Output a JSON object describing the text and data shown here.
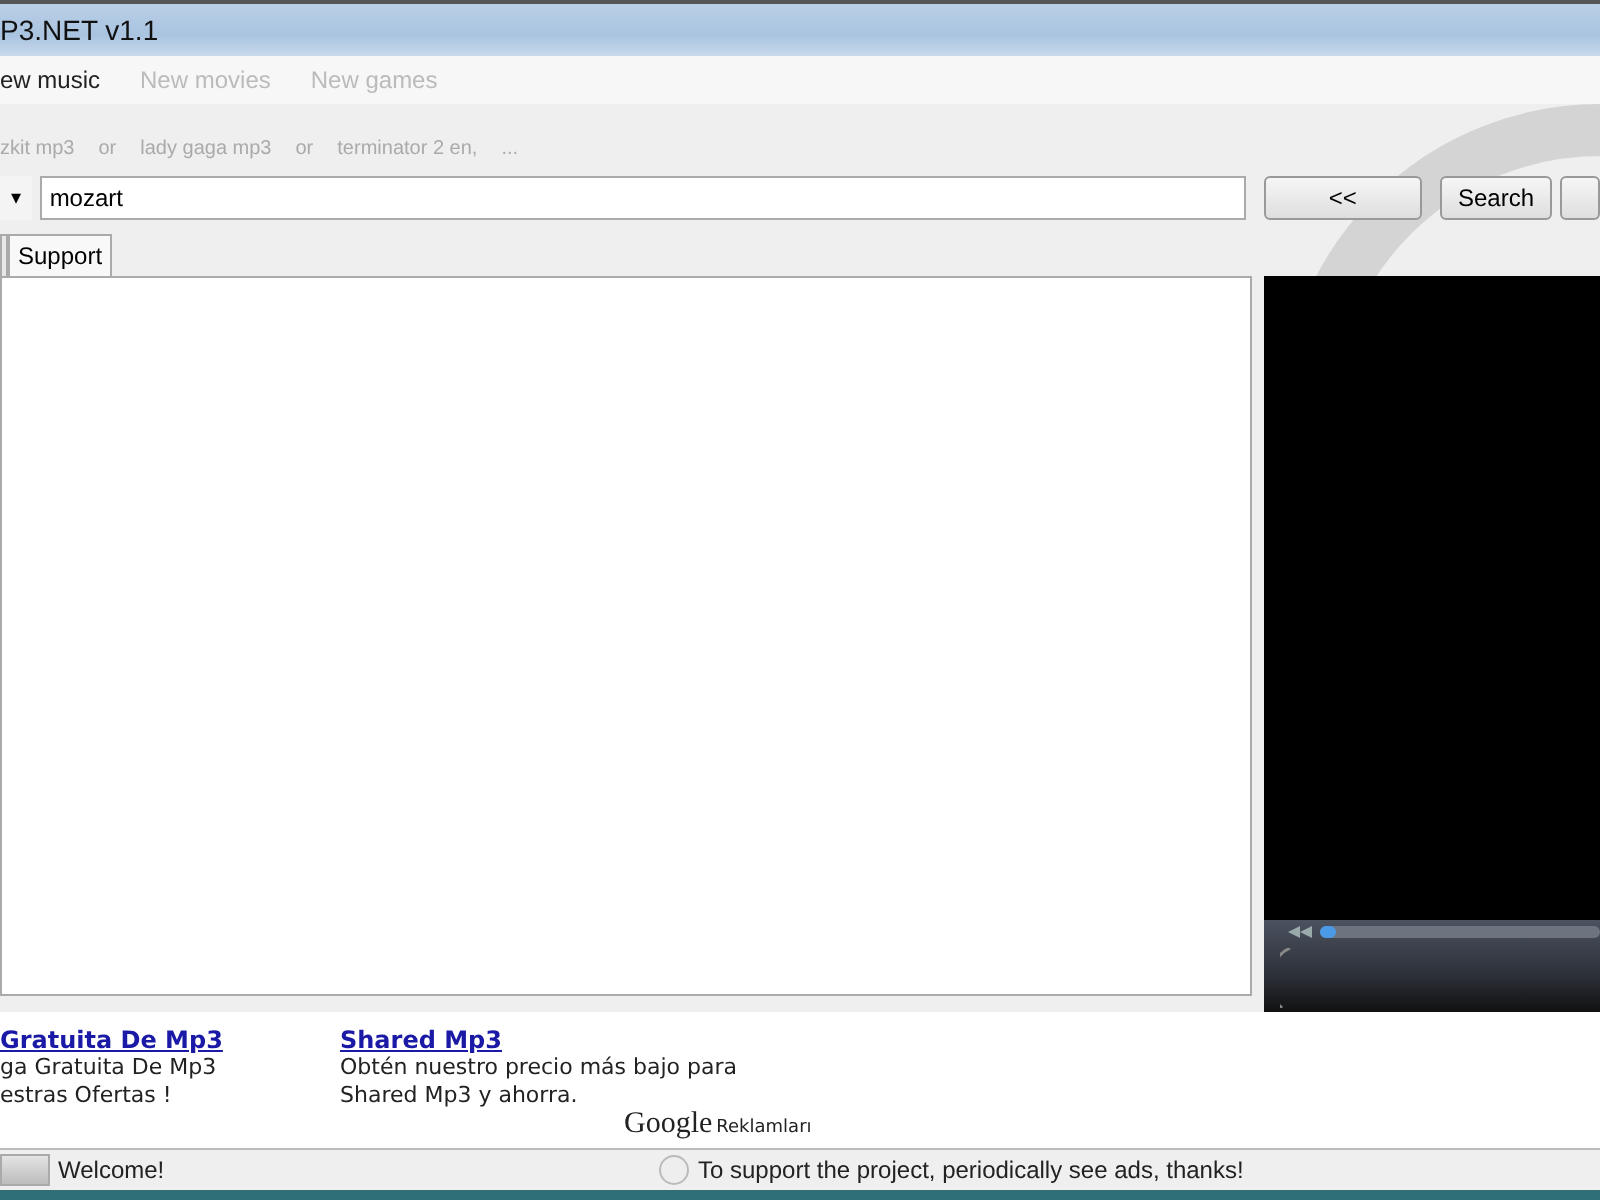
{
  "window": {
    "title": "P3.NET v1.1"
  },
  "nav": [
    {
      "label": "ew music",
      "selected": true
    },
    {
      "label": "New movies",
      "selected": false
    },
    {
      "label": "New games",
      "selected": false
    }
  ],
  "hints": [
    "zkit mp3",
    "or",
    "lady gaga mp3",
    "or",
    "terminator 2 en,",
    "..."
  ],
  "search": {
    "dropdown": "▾",
    "value": "mozart",
    "buttons": [
      "<<",
      "Search"
    ]
  },
  "tabs": [
    {
      "selected": false
    },
    {
      "label": "Support",
      "selected": true
    }
  ],
  "player": {
    "seek": {
      "level": 0.06
    }
  },
  "ads": [
    {
      "title": "Gratuita De Mp3",
      "lines": [
        "ga Gratuita De Mp3",
        "estras Ofertas !"
      ]
    },
    {
      "title": "Shared Mp3",
      "lines": [
        "Obtén nuestro precio más bajo para",
        "Shared Mp3 y ahorra."
      ]
    }
  ],
  "ads_footer": {
    "brand": "Google",
    "label": "Reklamları"
  },
  "status_bar": {
    "progress": {
      "level": 1
    },
    "left": "Welcome!",
    "right": "To support the project, periodically see ads, thanks!"
  }
}
